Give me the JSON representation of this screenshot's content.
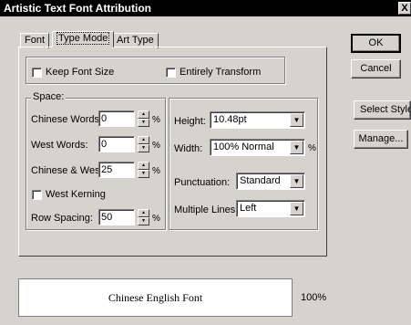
{
  "window": {
    "title": "Artistic Text Font Attribution",
    "close_label": "X"
  },
  "tabs": [
    {
      "label": "Font",
      "active": false
    },
    {
      "label": "Type Mode",
      "active": true
    },
    {
      "label": "Art Type",
      "active": false
    }
  ],
  "options": {
    "keep_font_size": "Keep Font Size",
    "entirely_transform": "Entirely Transform"
  },
  "space": {
    "group_label": "Space:",
    "chinese_words": {
      "label": "Chinese Words:",
      "value": "0"
    },
    "west_words": {
      "label": "West Words:",
      "value": "0"
    },
    "chinese_west": {
      "label": "Chinese & West:",
      "value": "25"
    },
    "west_kerning": "West Kerning",
    "row_spacing": {
      "label": "Row Spacing:",
      "value": "50"
    },
    "percent": "%"
  },
  "right": {
    "height": {
      "label": "Height:",
      "value": "10.48pt"
    },
    "width": {
      "label": "Width:",
      "value": "100% Normal"
    },
    "punctuation": {
      "label": "Punctuation:",
      "value": "Standard"
    },
    "multiple_lines": {
      "label": "Multiple Lines:",
      "value": "Left"
    },
    "percent": "%"
  },
  "buttons": {
    "ok": "OK",
    "cancel": "Cancel",
    "select_style": "Select Style",
    "manage": "Manage..."
  },
  "preview": {
    "text": "Chinese English Font",
    "zoom": "100%"
  }
}
